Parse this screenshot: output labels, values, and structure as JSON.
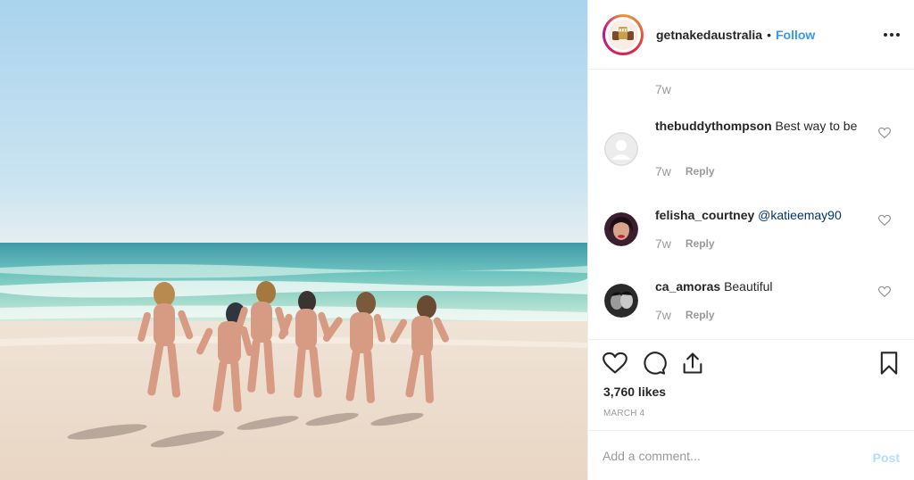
{
  "post": {
    "username": "getnakedaustralia",
    "separator": "•",
    "follow_label": "Follow",
    "more_icon": "more-horizontal-icon",
    "avatar_text": "NAKED",
    "photo_alt": "Beach photo"
  },
  "comments": {
    "top_time": "7w",
    "items": [
      {
        "user": "thebuddythompson",
        "text": "Best way to be",
        "time": "7w",
        "reply": "Reply",
        "avatar": "default-avatar"
      },
      {
        "user": "felisha_courtney",
        "text": "@katieemay90",
        "time": "7w",
        "reply": "Reply",
        "avatar": "profile-photo"
      },
      {
        "user": "ca_amoras",
        "text": "Beautiful",
        "time": "7w",
        "reply": "Reply",
        "avatar": "profile-photo"
      }
    ]
  },
  "actions": {
    "like_icon": "heart-icon",
    "comment_icon": "comment-bubble-icon",
    "share_icon": "share-icon",
    "save_icon": "bookmark-icon",
    "likes_text": "3,760 likes",
    "date_text": "MARCH 4"
  },
  "composer": {
    "placeholder": "Add a comment...",
    "post_label": "Post"
  },
  "colors": {
    "link": "#3897f0",
    "post_disabled": "#b2dffc",
    "mention": "#003569",
    "muted": "#999999"
  }
}
